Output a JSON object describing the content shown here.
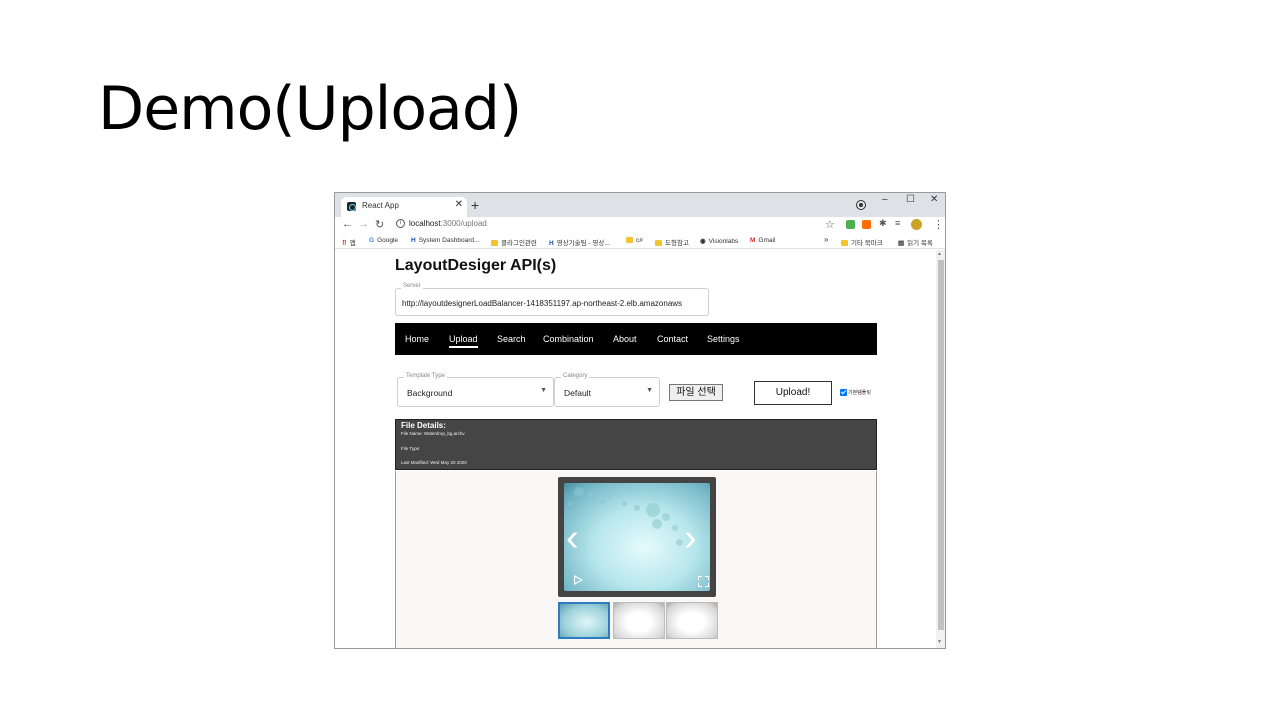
{
  "slide": {
    "title": "Demo(Upload)"
  },
  "browser": {
    "tab_title": "React App",
    "tab_close": "✕",
    "new_tab": "+",
    "win_min": "–",
    "win_max": "☐",
    "win_close": "✕",
    "url_host": "localhost",
    "url_path": ":3000/upload",
    "nav_back": "←",
    "nav_forward": "→",
    "nav_reload": "↻",
    "star": "☆",
    "menu": "⋮",
    "bookmarks": {
      "apps": "앱",
      "google": "Google",
      "system_dashboard": "System Dashboard...",
      "folder1": "클라그인관련",
      "video": "영상기술팀 - 영상...",
      "csharp": "c#",
      "folder2": "도형참고",
      "visionlabs": "Visionlabs",
      "gmail": "Gmail",
      "more": "»",
      "other": "기타 북마크",
      "reading": "읽기 목록"
    }
  },
  "app": {
    "title": "LayoutDesiger API(s)",
    "server_label": "Server",
    "server_value": "http://layoutdesignerLoadBalancer-1418351197.ap-northeast-2.elb.amazonaws",
    "nav": [
      "Home",
      "Upload",
      "Search",
      "Combination",
      "About",
      "Contact",
      "Settings"
    ],
    "active_nav": "Upload",
    "template_type_label": "Template Type",
    "template_type_value": "Background",
    "category_label": "Category",
    "category_value": "Default",
    "file_button": "파일 선택",
    "upload_button": "Upload!",
    "checkbox_label": "기본템플릿",
    "checkbox_checked": true,
    "details_title": "File Details:",
    "file_name": "File Name: Waterdrop_bg.archv",
    "file_type": "File Type:",
    "last_modified": "Last Modified: Wed May 20 2020",
    "gallery_prev": "‹",
    "gallery_next": "›"
  },
  "colors": {
    "navbar": "#000000",
    "details_bg": "#454545",
    "accent": "#2e7cbf",
    "checkbox": "#0075ff"
  },
  "icons": [
    "react-icon",
    "close-icon",
    "plus-icon",
    "record-icon",
    "minimize-icon",
    "maximize-icon",
    "back-icon",
    "forward-icon",
    "reload-icon",
    "info-icon",
    "star-icon",
    "extension-icon",
    "menu-icon",
    "apps-icon",
    "google-icon",
    "folder-icon",
    "gmail-icon",
    "play-icon",
    "fullscreen-icon",
    "dropdown-icon"
  ]
}
